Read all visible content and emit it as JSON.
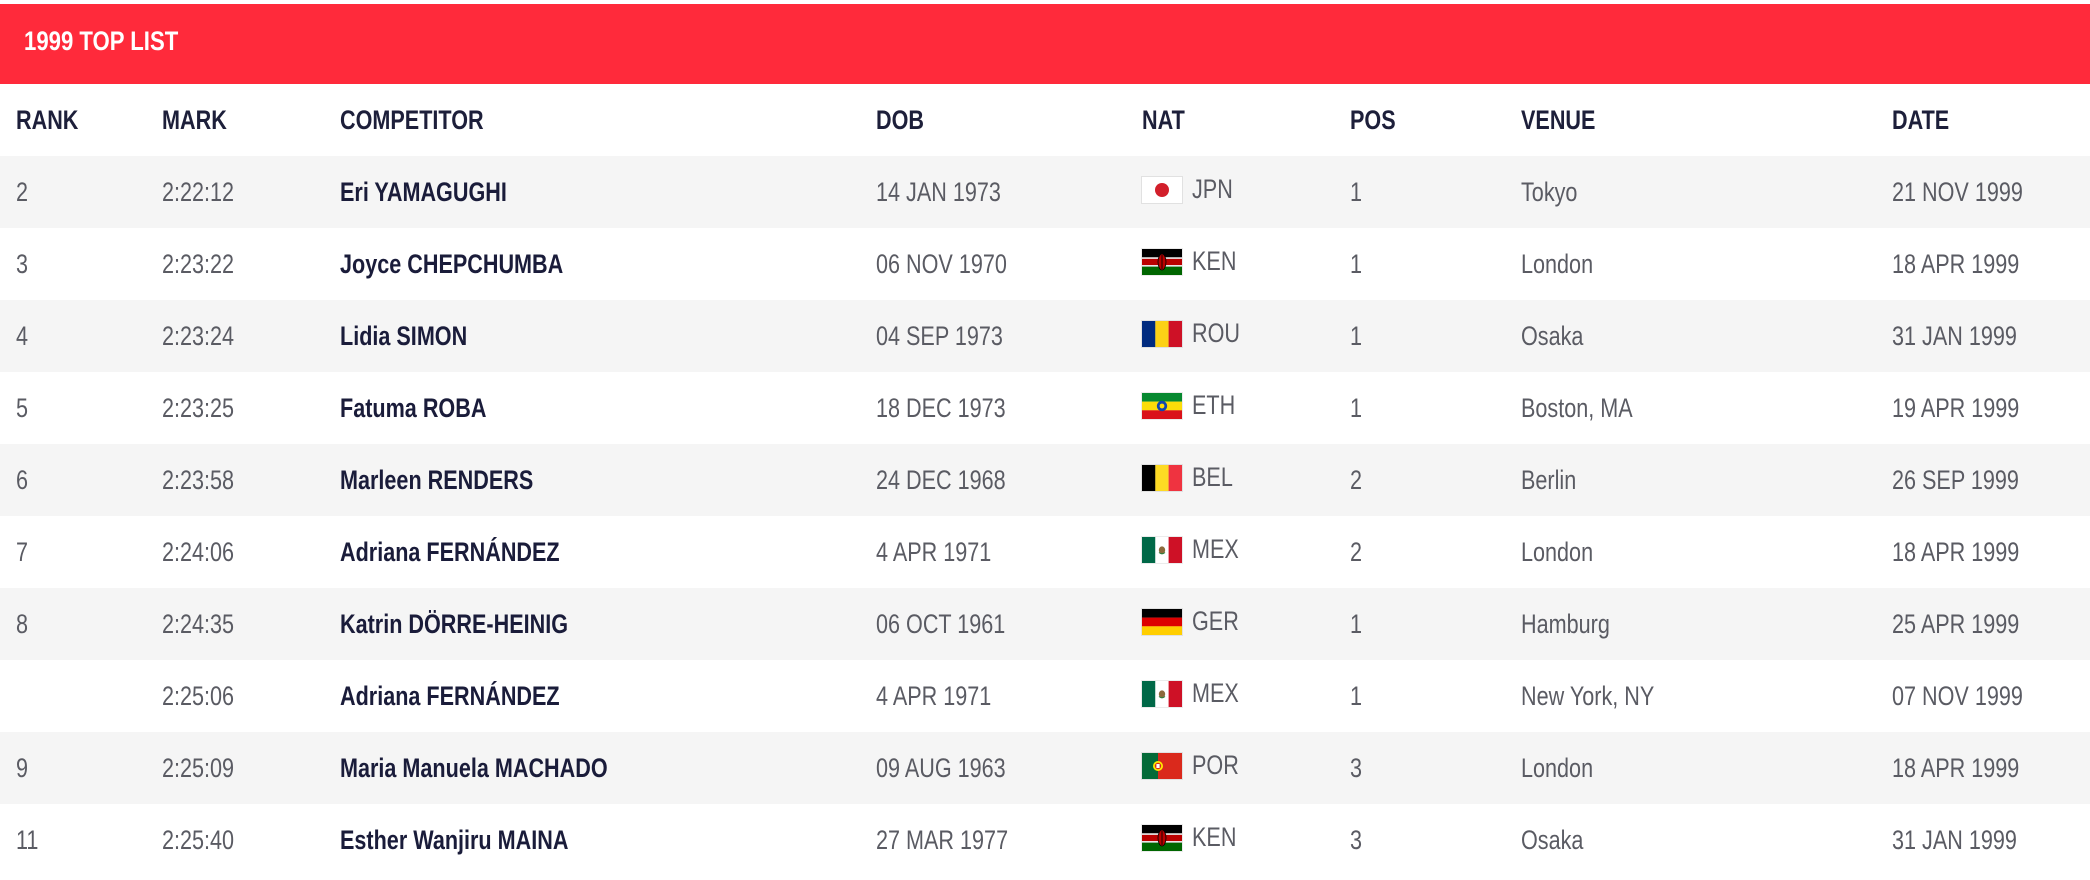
{
  "header": {
    "title": "1999 TOP LIST"
  },
  "columns": [
    "RANK",
    "MARK",
    "COMPETITOR",
    "DOB",
    "NAT",
    "POS",
    "VENUE",
    "DATE"
  ],
  "rows": [
    {
      "rank": "2",
      "mark": "2:22:12",
      "competitor": "Eri YAMAGUGHI",
      "dob": "14 JAN 1973",
      "nat": "JPN",
      "flag": "japan-flag-icon",
      "pos": "1",
      "venue": "Tokyo",
      "date": "21 NOV 1999"
    },
    {
      "rank": "3",
      "mark": "2:23:22",
      "competitor": "Joyce CHEPCHUMBA",
      "dob": "06 NOV 1970",
      "nat": "KEN",
      "flag": "kenya-flag-icon",
      "pos": "1",
      "venue": "London",
      "date": "18 APR 1999"
    },
    {
      "rank": "4",
      "mark": "2:23:24",
      "competitor": "Lidia SIMON",
      "dob": "04 SEP 1973",
      "nat": "ROU",
      "flag": "romania-flag-icon",
      "pos": "1",
      "venue": "Osaka",
      "date": "31 JAN 1999"
    },
    {
      "rank": "5",
      "mark": "2:23:25",
      "competitor": "Fatuma ROBA",
      "dob": "18 DEC 1973",
      "nat": "ETH",
      "flag": "ethiopia-flag-icon",
      "pos": "1",
      "venue": "Boston, MA",
      "date": "19 APR 1999"
    },
    {
      "rank": "6",
      "mark": "2:23:58",
      "competitor": "Marleen RENDERS",
      "dob": "24 DEC 1968",
      "nat": "BEL",
      "flag": "belgium-flag-icon",
      "pos": "2",
      "venue": "Berlin",
      "date": "26 SEP 1999"
    },
    {
      "rank": "7",
      "mark": "2:24:06",
      "competitor": "Adriana FERNÁNDEZ",
      "dob": "4 APR 1971",
      "nat": "MEX",
      "flag": "mexico-flag-icon",
      "pos": "2",
      "venue": "London",
      "date": "18 APR 1999"
    },
    {
      "rank": "8",
      "mark": "2:24:35",
      "competitor": "Katrin DÖRRE-HEINIG",
      "dob": "06 OCT 1961",
      "nat": "GER",
      "flag": "germany-flag-icon",
      "pos": "1",
      "venue": "Hamburg",
      "date": "25 APR 1999"
    },
    {
      "rank": "",
      "mark": "2:25:06",
      "competitor": "Adriana FERNÁNDEZ",
      "dob": "4 APR 1971",
      "nat": "MEX",
      "flag": "mexico-flag-icon",
      "pos": "1",
      "venue": "New York, NY",
      "date": "07 NOV 1999"
    },
    {
      "rank": "9",
      "mark": "2:25:09",
      "competitor": "Maria Manuela MACHADO",
      "dob": "09 AUG 1963",
      "nat": "POR",
      "flag": "portugal-flag-icon",
      "pos": "3",
      "venue": "London",
      "date": "18 APR 1999"
    },
    {
      "rank": "11",
      "mark": "2:25:40",
      "competitor": "Esther Wanjiru MAINA",
      "dob": "27 MAR 1977",
      "nat": "KEN",
      "flag": "kenya-flag-icon",
      "pos": "3",
      "venue": "Osaka",
      "date": "31 JAN 1999"
    }
  ],
  "colors": {
    "header_bg": "#ff2a3b",
    "header_text": "#ffffff",
    "row_alt": "#f5f5f5",
    "primary_text": "#1a1c3a",
    "muted_text": "#5a5b63"
  }
}
